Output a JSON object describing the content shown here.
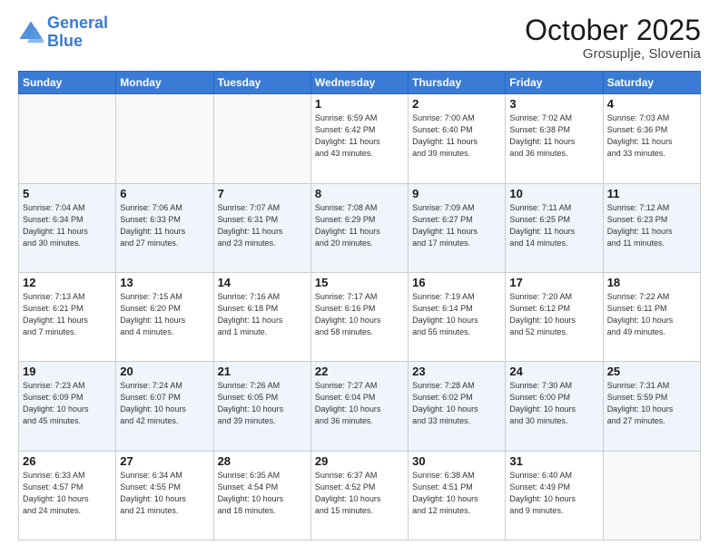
{
  "logo": {
    "line1": "General",
    "line2": "Blue"
  },
  "title": "October 2025",
  "subtitle": "Grosuplje, Slovenia",
  "weekdays": [
    "Sunday",
    "Monday",
    "Tuesday",
    "Wednesday",
    "Thursday",
    "Friday",
    "Saturday"
  ],
  "weeks": [
    [
      {
        "day": "",
        "info": ""
      },
      {
        "day": "",
        "info": ""
      },
      {
        "day": "",
        "info": ""
      },
      {
        "day": "1",
        "info": "Sunrise: 6:59 AM\nSunset: 6:42 PM\nDaylight: 11 hours\nand 43 minutes."
      },
      {
        "day": "2",
        "info": "Sunrise: 7:00 AM\nSunset: 6:40 PM\nDaylight: 11 hours\nand 39 minutes."
      },
      {
        "day": "3",
        "info": "Sunrise: 7:02 AM\nSunset: 6:38 PM\nDaylight: 11 hours\nand 36 minutes."
      },
      {
        "day": "4",
        "info": "Sunrise: 7:03 AM\nSunset: 6:36 PM\nDaylight: 11 hours\nand 33 minutes."
      }
    ],
    [
      {
        "day": "5",
        "info": "Sunrise: 7:04 AM\nSunset: 6:34 PM\nDaylight: 11 hours\nand 30 minutes."
      },
      {
        "day": "6",
        "info": "Sunrise: 7:06 AM\nSunset: 6:33 PM\nDaylight: 11 hours\nand 27 minutes."
      },
      {
        "day": "7",
        "info": "Sunrise: 7:07 AM\nSunset: 6:31 PM\nDaylight: 11 hours\nand 23 minutes."
      },
      {
        "day": "8",
        "info": "Sunrise: 7:08 AM\nSunset: 6:29 PM\nDaylight: 11 hours\nand 20 minutes."
      },
      {
        "day": "9",
        "info": "Sunrise: 7:09 AM\nSunset: 6:27 PM\nDaylight: 11 hours\nand 17 minutes."
      },
      {
        "day": "10",
        "info": "Sunrise: 7:11 AM\nSunset: 6:25 PM\nDaylight: 11 hours\nand 14 minutes."
      },
      {
        "day": "11",
        "info": "Sunrise: 7:12 AM\nSunset: 6:23 PM\nDaylight: 11 hours\nand 11 minutes."
      }
    ],
    [
      {
        "day": "12",
        "info": "Sunrise: 7:13 AM\nSunset: 6:21 PM\nDaylight: 11 hours\nand 7 minutes."
      },
      {
        "day": "13",
        "info": "Sunrise: 7:15 AM\nSunset: 6:20 PM\nDaylight: 11 hours\nand 4 minutes."
      },
      {
        "day": "14",
        "info": "Sunrise: 7:16 AM\nSunset: 6:18 PM\nDaylight: 11 hours\nand 1 minute."
      },
      {
        "day": "15",
        "info": "Sunrise: 7:17 AM\nSunset: 6:16 PM\nDaylight: 10 hours\nand 58 minutes."
      },
      {
        "day": "16",
        "info": "Sunrise: 7:19 AM\nSunset: 6:14 PM\nDaylight: 10 hours\nand 55 minutes."
      },
      {
        "day": "17",
        "info": "Sunrise: 7:20 AM\nSunset: 6:12 PM\nDaylight: 10 hours\nand 52 minutes."
      },
      {
        "day": "18",
        "info": "Sunrise: 7:22 AM\nSunset: 6:11 PM\nDaylight: 10 hours\nand 49 minutes."
      }
    ],
    [
      {
        "day": "19",
        "info": "Sunrise: 7:23 AM\nSunset: 6:09 PM\nDaylight: 10 hours\nand 45 minutes."
      },
      {
        "day": "20",
        "info": "Sunrise: 7:24 AM\nSunset: 6:07 PM\nDaylight: 10 hours\nand 42 minutes."
      },
      {
        "day": "21",
        "info": "Sunrise: 7:26 AM\nSunset: 6:05 PM\nDaylight: 10 hours\nand 39 minutes."
      },
      {
        "day": "22",
        "info": "Sunrise: 7:27 AM\nSunset: 6:04 PM\nDaylight: 10 hours\nand 36 minutes."
      },
      {
        "day": "23",
        "info": "Sunrise: 7:28 AM\nSunset: 6:02 PM\nDaylight: 10 hours\nand 33 minutes."
      },
      {
        "day": "24",
        "info": "Sunrise: 7:30 AM\nSunset: 6:00 PM\nDaylight: 10 hours\nand 30 minutes."
      },
      {
        "day": "25",
        "info": "Sunrise: 7:31 AM\nSunset: 5:59 PM\nDaylight: 10 hours\nand 27 minutes."
      }
    ],
    [
      {
        "day": "26",
        "info": "Sunrise: 6:33 AM\nSunset: 4:57 PM\nDaylight: 10 hours\nand 24 minutes."
      },
      {
        "day": "27",
        "info": "Sunrise: 6:34 AM\nSunset: 4:55 PM\nDaylight: 10 hours\nand 21 minutes."
      },
      {
        "day": "28",
        "info": "Sunrise: 6:35 AM\nSunset: 4:54 PM\nDaylight: 10 hours\nand 18 minutes."
      },
      {
        "day": "29",
        "info": "Sunrise: 6:37 AM\nSunset: 4:52 PM\nDaylight: 10 hours\nand 15 minutes."
      },
      {
        "day": "30",
        "info": "Sunrise: 6:38 AM\nSunset: 4:51 PM\nDaylight: 10 hours\nand 12 minutes."
      },
      {
        "day": "31",
        "info": "Sunrise: 6:40 AM\nSunset: 4:49 PM\nDaylight: 10 hours\nand 9 minutes."
      },
      {
        "day": "",
        "info": ""
      }
    ]
  ]
}
